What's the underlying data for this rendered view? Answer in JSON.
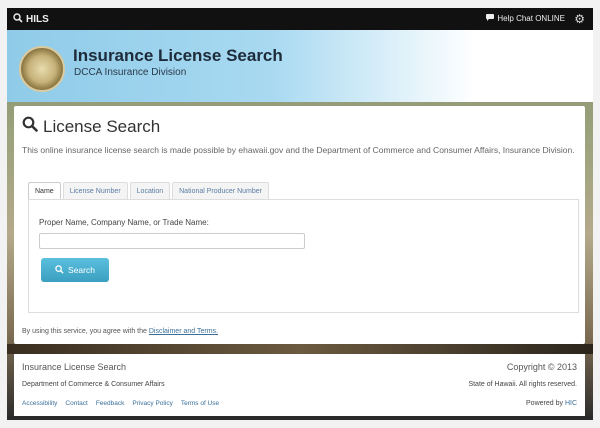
{
  "topbar": {
    "brand": "HILS",
    "chat_label": "Help Chat ONLINE"
  },
  "banner": {
    "title": "Insurance License Search",
    "subtitle": "DCCA Insurance Division"
  },
  "main": {
    "heading": "License Search",
    "intro": "This online insurance license search is made possible by ehawaii.gov and the Department of Commerce and Consumer Affairs, Insurance Division.",
    "tabs": [
      {
        "label": "Name",
        "active": true
      },
      {
        "label": "License Number",
        "active": false
      },
      {
        "label": "Location",
        "active": false
      },
      {
        "label": "National Producer Number",
        "active": false
      }
    ],
    "field_label": "Proper Name, Company Name, or Trade Name:",
    "field_value": "",
    "search_button": "Search",
    "terms_prefix": "By using this service, you agree with the",
    "terms_link": "Disclaimer and Terms."
  },
  "footer": {
    "title": "Insurance License Search",
    "department": "Department of Commerce & Consumer Affairs",
    "links": [
      "Accessibility",
      "Contact",
      "Feedback",
      "Privacy Policy",
      "Terms of Use"
    ],
    "copyright": "Copyright © 2013",
    "rights": "State of Hawaii. All rights reserved.",
    "powered_prefix": "Powered by",
    "powered_link": "HIC"
  },
  "colors": {
    "accent": "#5bc0de",
    "link": "#3b6f9a",
    "topbar": "#111111"
  }
}
